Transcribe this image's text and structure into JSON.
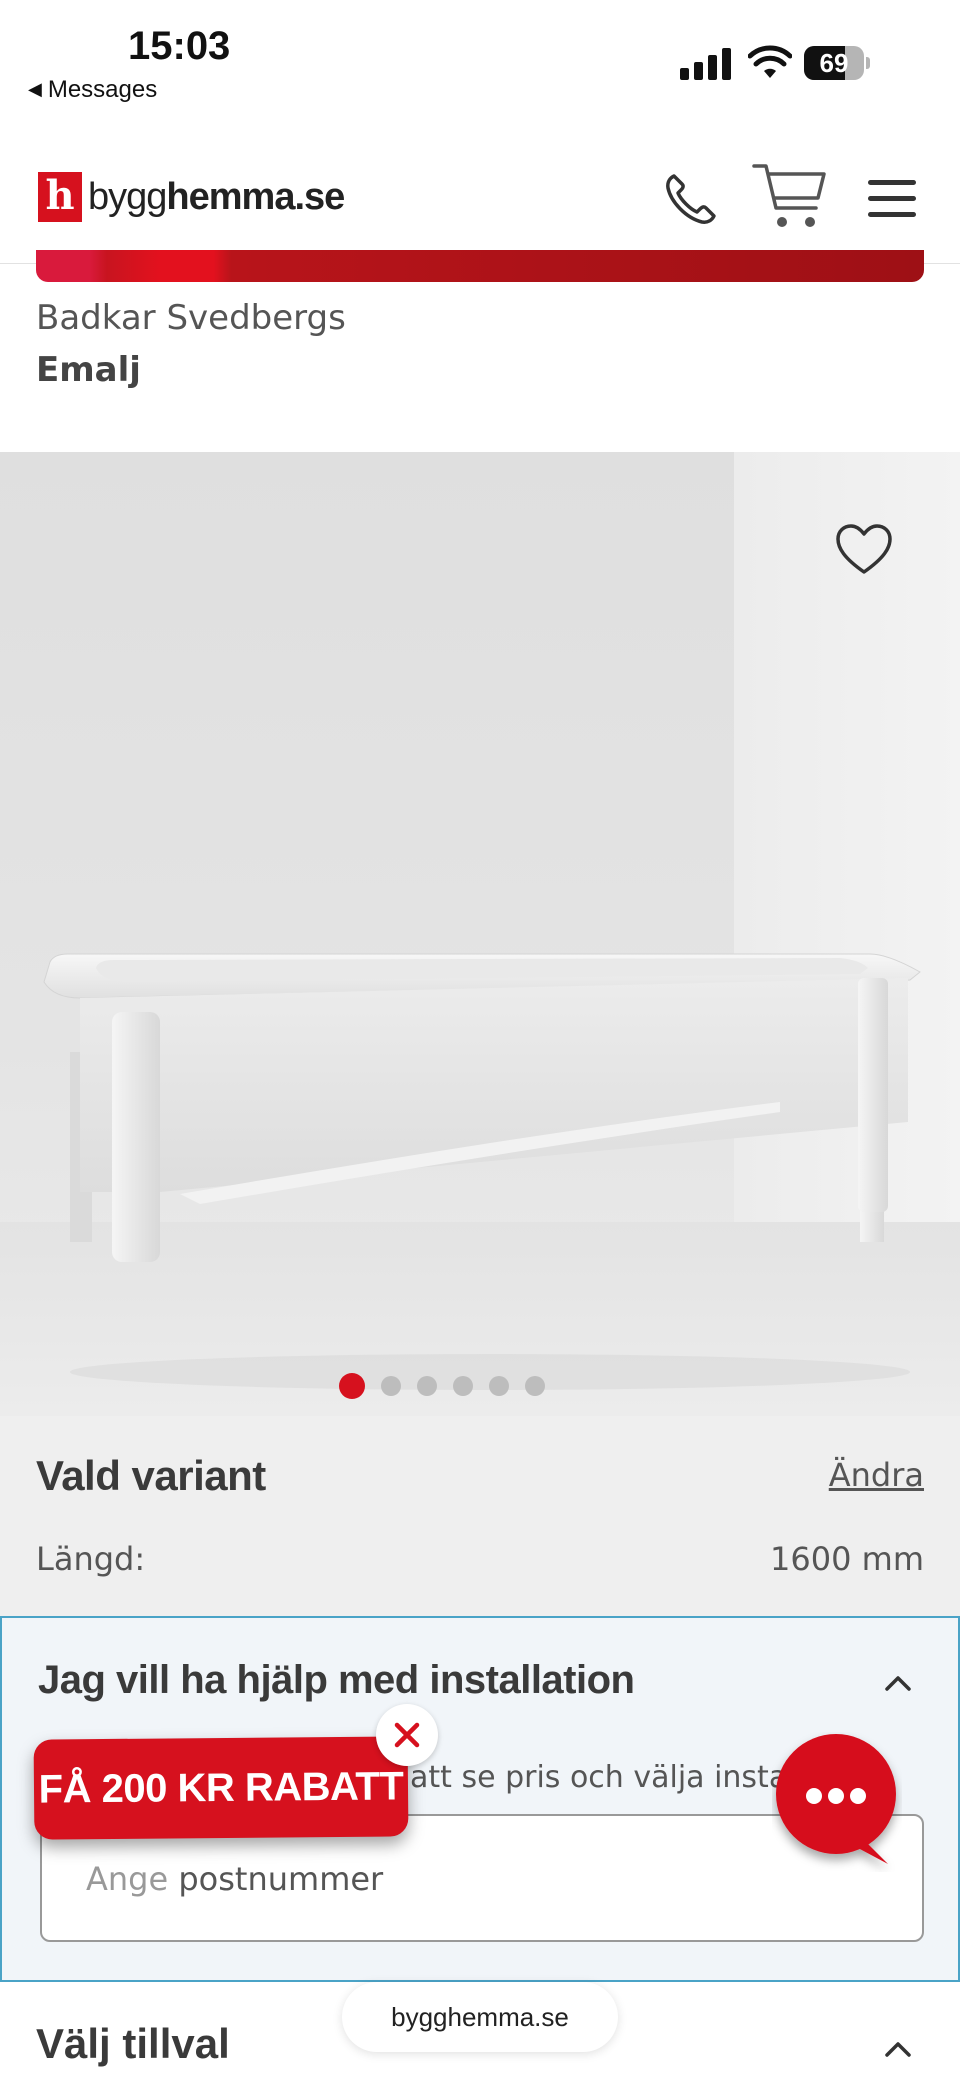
{
  "status_bar": {
    "time": "15:03",
    "back_label": "Messages",
    "battery_percent": 69,
    "battery_text": "69"
  },
  "header": {
    "logo_mark": "h",
    "logo_text_light": "bygg",
    "logo_text_bold": "hemma.se",
    "icons": [
      "phone-icon",
      "cart-icon",
      "menu-icon"
    ]
  },
  "product": {
    "brand_line": "Badkar Svedbergs",
    "variant_name": "Emalj"
  },
  "gallery": {
    "image_count": 6,
    "active_index": 1,
    "favorite_icon": "heart-icon"
  },
  "selected_variant": {
    "title": "Vald variant",
    "change_label": "Ändra",
    "length_label": "Längd:",
    "length_value": "1600 mm"
  },
  "installation": {
    "title": "Jag vill ha hjälp med installation",
    "description": "att se pris och välja installa",
    "postcode_placeholder_hint": "Ange",
    "postcode_placeholder_rest": " postnummer"
  },
  "addons": {
    "title": "Välj tillval"
  },
  "browser": {
    "url": "bygghemma.se"
  },
  "discount": {
    "label": "FÅ 200 KR RABATT"
  },
  "colors": {
    "brand_red": "#d6111e",
    "install_border": "#4aa3c7",
    "variant_bg": "#efefef"
  }
}
